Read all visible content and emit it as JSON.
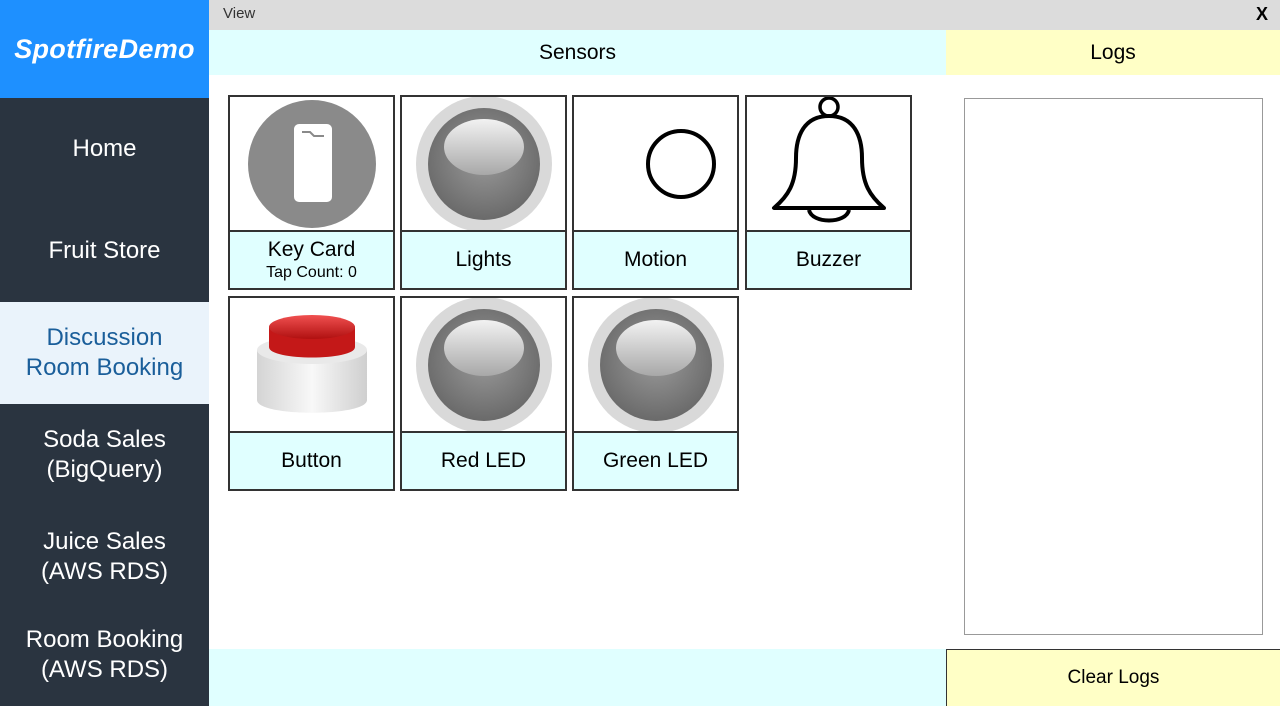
{
  "topbar": {
    "view_label": "View",
    "close_label": "X"
  },
  "sidebar": {
    "brand": "SpotfireDemo",
    "items": [
      {
        "label": "Home"
      },
      {
        "label": "Fruit Store"
      },
      {
        "label": "Discussion\nRoom Booking"
      },
      {
        "label": "Soda Sales\n(BigQuery)"
      },
      {
        "label": "Juice Sales\n(AWS RDS)"
      },
      {
        "label": "Room Booking\n(AWS RDS)"
      }
    ],
    "active_index": 2
  },
  "sensors": {
    "header": "Sensors",
    "tiles": [
      {
        "label": "Key Card",
        "sub": "Tap Count: 0",
        "icon": "key-card-icon"
      },
      {
        "label": "Lights",
        "icon": "light-bulb-icon"
      },
      {
        "label": "Motion",
        "icon": "motion-circle-icon"
      },
      {
        "label": "Buzzer",
        "icon": "bell-icon"
      },
      {
        "label": "Button",
        "icon": "red-push-button-icon"
      },
      {
        "label": "Red LED",
        "icon": "led-icon"
      },
      {
        "label": "Green LED",
        "icon": "led-icon"
      }
    ]
  },
  "logs": {
    "header": "Logs",
    "clear_label": "Clear Logs"
  },
  "colors": {
    "sidebar_bg": "#2a3440",
    "brand_bg": "#1e90ff",
    "active_nav_bg": "#eaf3fb",
    "sensor_header_bg": "#e0ffff",
    "logs_header_bg": "#ffffc6"
  }
}
